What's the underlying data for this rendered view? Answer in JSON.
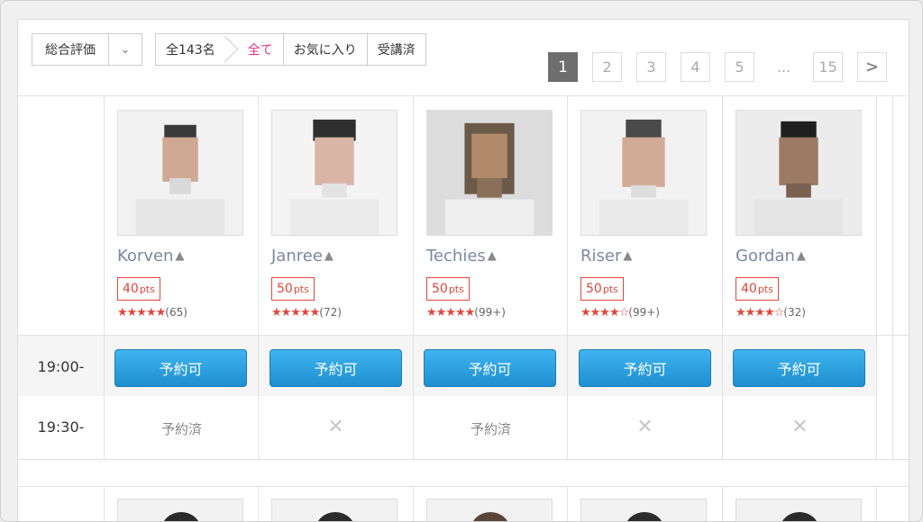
{
  "toolbar": {
    "sort_label": "総合評価",
    "filter_count": "全143名",
    "filter_all": "全て",
    "filter_favorites": "お気に入り",
    "filter_taken": "受講済"
  },
  "pagination": {
    "pages": [
      "1",
      "2",
      "3",
      "4",
      "5"
    ],
    "ellipsis": "...",
    "last": "15",
    "next": ">",
    "current": "1"
  },
  "teachers": [
    {
      "name": "Korven",
      "points": "40",
      "unit": "pts",
      "stars": "★★★★★",
      "reviews": "(65)"
    },
    {
      "name": "Janree",
      "points": "50",
      "unit": "pts",
      "stars": "★★★★★",
      "reviews": "(72)"
    },
    {
      "name": "Techies",
      "points": "50",
      "unit": "pts",
      "stars": "★★★★★",
      "reviews": "(99+)"
    },
    {
      "name": "Riser",
      "points": "50",
      "unit": "pts",
      "stars": "★★★★☆",
      "reviews": "(99+)"
    },
    {
      "name": "Gordan",
      "points": "40",
      "unit": "pts",
      "stars": "★★★★☆",
      "reviews": "(32)"
    }
  ],
  "slots": [
    {
      "time": "19:00-",
      "cells": [
        "予約可",
        "予約可",
        "予約可",
        "予約可",
        "予約可"
      ]
    },
    {
      "time": "19:30-",
      "cells": [
        "予約済",
        "✕",
        "予約済",
        "✕",
        "✕"
      ]
    }
  ],
  "icons": {
    "chevron": "chevron-down-icon",
    "cap": "graduation-cap-icon",
    "unavailable": "close-icon"
  },
  "colors": {
    "accent_pink": "#e0338d",
    "points_red": "#e0463c",
    "button_blue": "#2aa0e0",
    "name_gray_blue": "#7b88a4"
  }
}
